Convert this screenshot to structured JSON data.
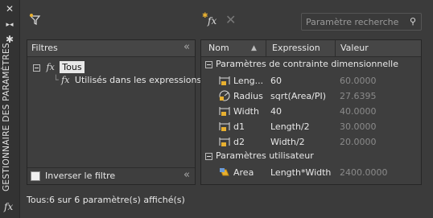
{
  "palette": {
    "title": "GESTIONNAIRE DES PARAMÈTRES"
  },
  "toolbar": {
    "search_placeholder": "Paramètre recherche"
  },
  "filters": {
    "header": "Filtres",
    "tree": [
      {
        "label": "Tous",
        "selected": true
      },
      {
        "label": "Utilisés dans les expressions",
        "selected": false
      }
    ],
    "invert_label": "Inverser le filtre",
    "invert_checked": false
  },
  "params": {
    "columns": {
      "name": "Nom",
      "expression": "Expression",
      "value": "Valeur"
    },
    "groups": [
      {
        "label": "Paramètres de contrainte dimensionnelle",
        "rows": [
          {
            "icon": "linear-dimension-lock-icon",
            "name": "Leng...",
            "expression": "60",
            "value": "60.0000"
          },
          {
            "icon": "radius-dimension-icon",
            "name": "Radius",
            "expression": "sqrt(Area/PI)",
            "value": "27.6395"
          },
          {
            "icon": "linear-dimension-lock-icon",
            "name": "Width",
            "expression": "40",
            "value": "40.0000"
          },
          {
            "icon": "linear-dimension-lock-icon",
            "name": "d1",
            "expression": "Length/2",
            "value": "30.0000"
          },
          {
            "icon": "linear-dimension-lock-icon",
            "name": "d2",
            "expression": "Width/2",
            "value": "20.0000"
          }
        ]
      },
      {
        "label": "Paramètres utilisateur",
        "rows": [
          {
            "icon": "user-parameter-icon",
            "name": "Area",
            "expression": "Length*Width",
            "value": "2400.0000"
          }
        ]
      }
    ]
  },
  "status": "Tous:6 sur 6 paramètre(s) affiché(s)"
}
